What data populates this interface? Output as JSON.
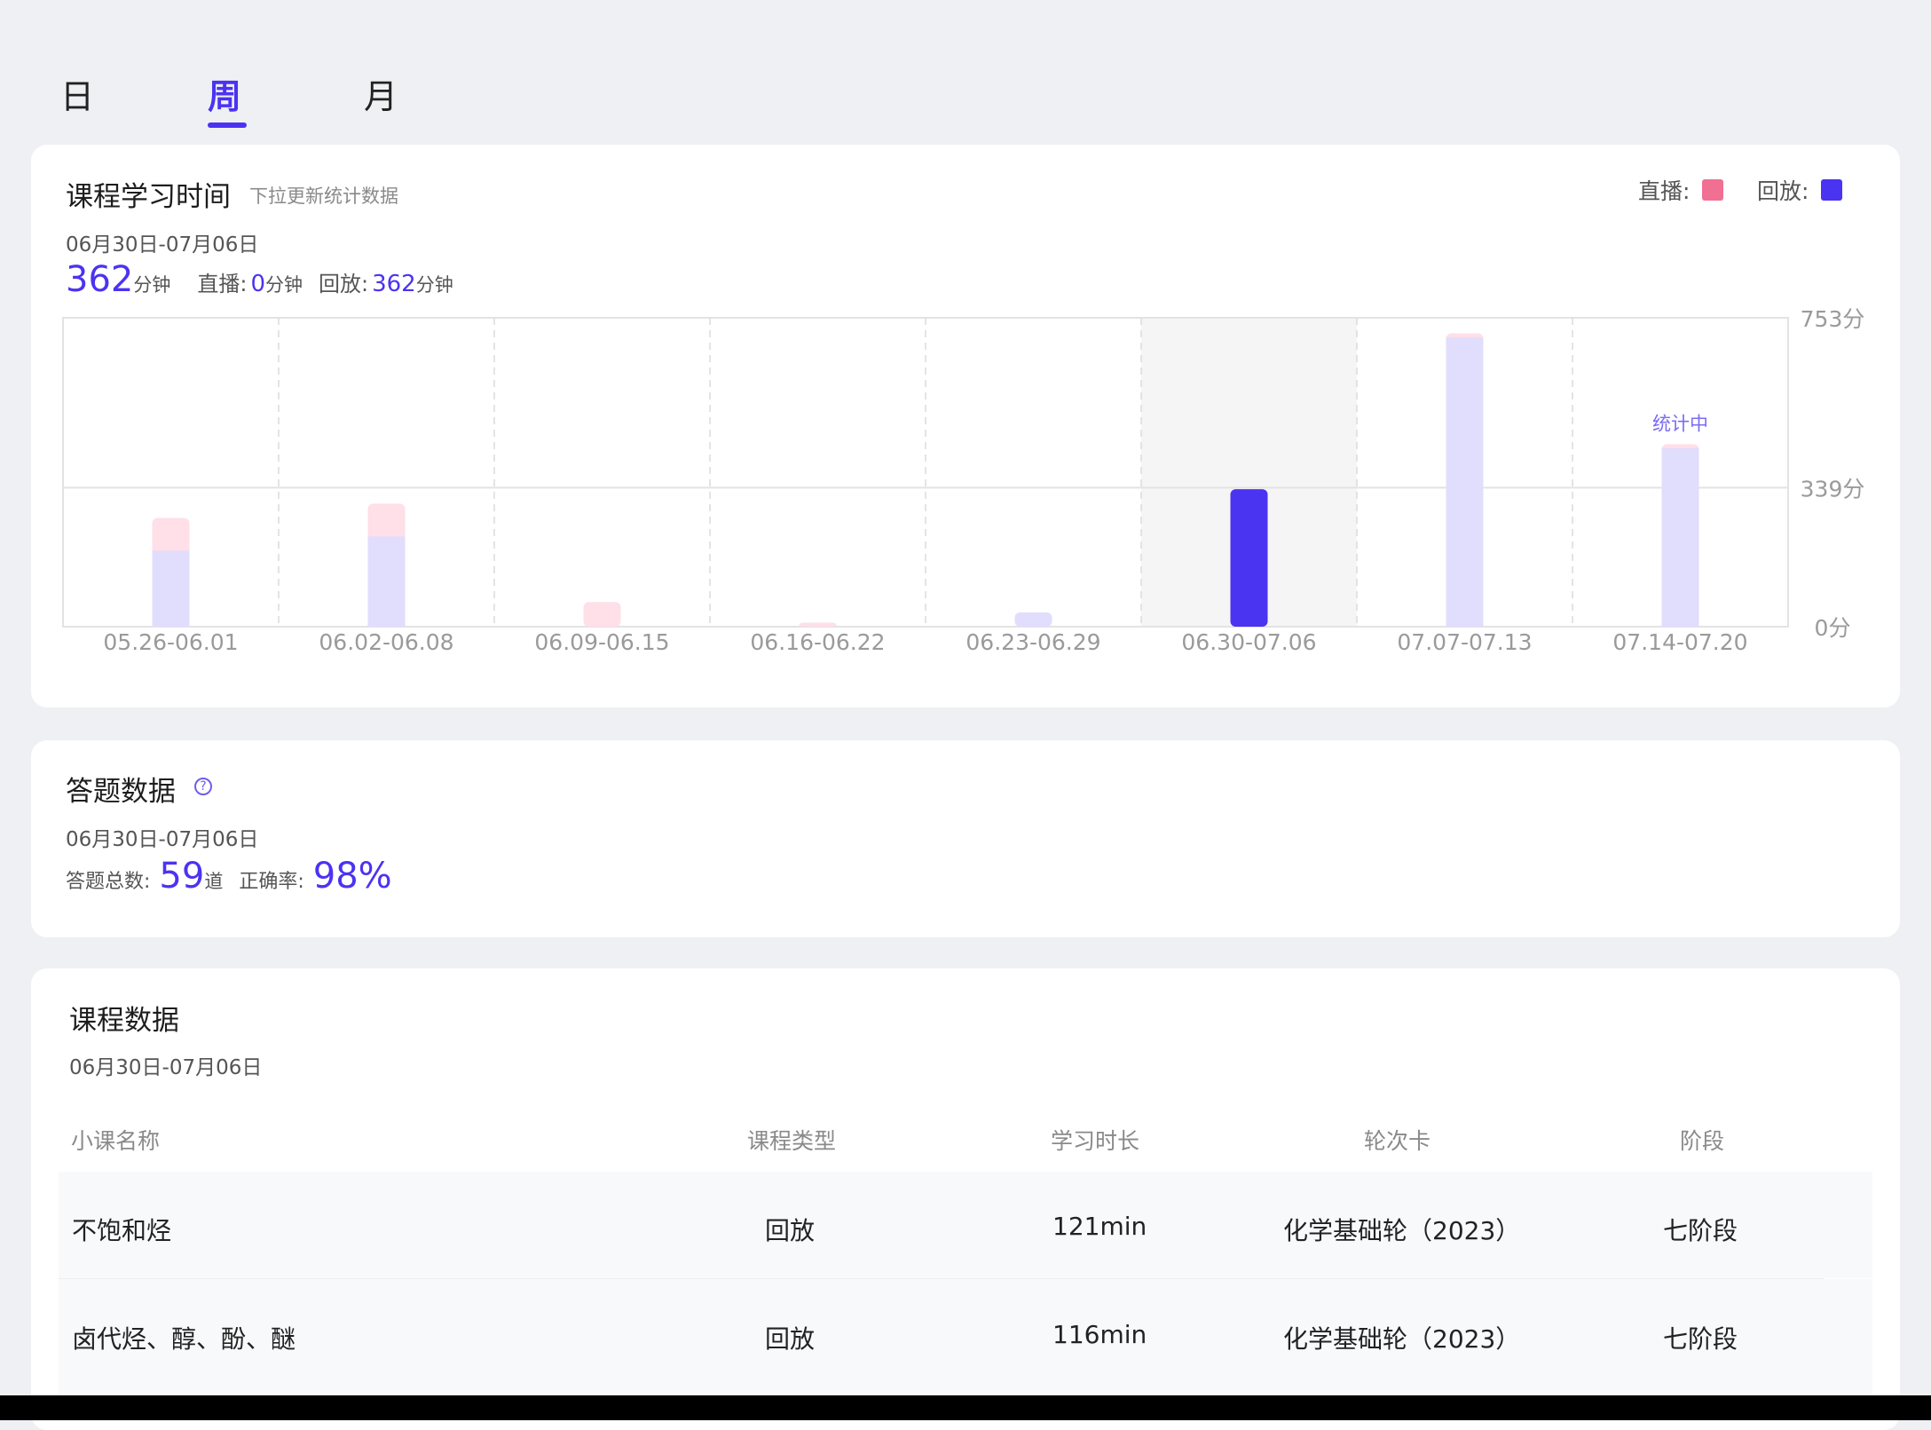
{
  "tabs": [
    {
      "label": "日",
      "active": false
    },
    {
      "label": "周",
      "active": true
    },
    {
      "label": "月",
      "active": false
    }
  ],
  "study_time": {
    "title": "课程学习时间",
    "hint": "下拉更新统计数据",
    "legend": {
      "live_label": "直播:",
      "replay_label": "回放:"
    },
    "range": "06月30日-07月06日",
    "total": "362",
    "total_unit": "分钟",
    "live_label": "直播:",
    "live_value": "0",
    "live_unit": "分钟",
    "replay_label": "回放:",
    "replay_value": "362",
    "replay_unit": "分钟"
  },
  "colors": {
    "accent": "#4b33f2",
    "live": "#f06f93",
    "replay": "#4b33f2",
    "live_faded": "#ffdfe8",
    "replay_faded": "#e1ddfd",
    "highlight_band": "#f5f5f5"
  },
  "chart_data": {
    "type": "bar",
    "stacked": true,
    "categories": [
      "05.26-06.01",
      "06.02-06.08",
      "06.09-06.15",
      "06.16-06.22",
      "06.23-06.29",
      "06.30-07.06",
      "07.07-07.13",
      "07.14-07.20"
    ],
    "series": [
      {
        "name": "回放",
        "values": [
          185,
          220,
          0,
          0,
          35,
          335,
          705,
          435
        ]
      },
      {
        "name": "直播",
        "values": [
          80,
          80,
          60,
          10,
          0,
          0,
          10,
          10
        ]
      }
    ],
    "y_ticks": [
      "753分",
      "339分",
      "0分"
    ],
    "y_tick_values": [
      753,
      339,
      0
    ],
    "ylim": [
      0,
      753
    ],
    "highlight_category": "06.30-07.06",
    "annotation": {
      "category": "07.14-07.20",
      "text": "统计中"
    },
    "grid": true
  },
  "answer": {
    "title": "答题数据",
    "help_icon": "question-circle-icon",
    "range": "06月30日-07月06日",
    "total_label": "答题总数:",
    "total_value": "59",
    "total_unit": "道",
    "accuracy_label": "正确率:",
    "accuracy_value": "98%"
  },
  "course": {
    "title": "课程数据",
    "range": "06月30日-07月06日",
    "headers": [
      "小课名称",
      "课程类型",
      "学习时长",
      "轮次卡",
      "阶段"
    ],
    "rows": [
      [
        "不饱和烃",
        "回放",
        "121min",
        "化学基础轮（2023）",
        "七阶段"
      ],
      [
        "卤代烃、醇、酚、醚",
        "回放",
        "116min",
        "化学基础轮（2023）",
        "七阶段"
      ]
    ]
  }
}
